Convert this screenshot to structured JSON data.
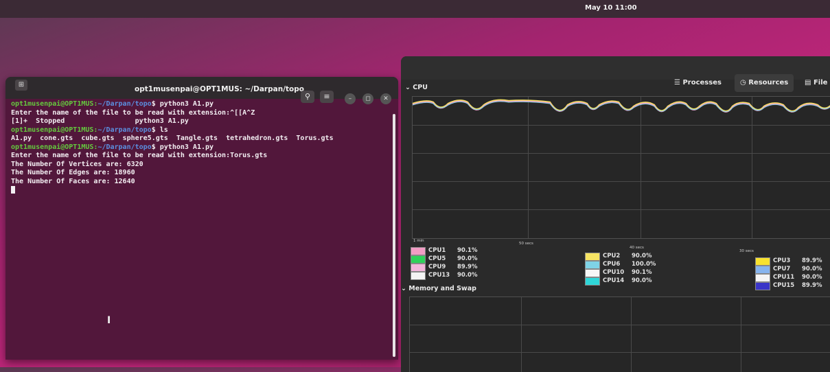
{
  "topbar": {
    "clock": "May 10  11:00"
  },
  "terminal": {
    "title": "opt1musenpai@OPT1MUS: ~/Darpan/topo",
    "new_tab_icon": "new-tab-icon",
    "buttons": {
      "search": "⚲",
      "menu": "≡",
      "minimize": "–",
      "maximize": "◻",
      "close": "✕"
    },
    "lines": [
      {
        "prompt": "opt1musenpai@OPT1MUS:",
        "path": "~/Darpan/topo",
        "text": "$ python3 A1.py"
      },
      {
        "text": "Enter the name of the file to be read with extension:^[[A^Z"
      },
      {
        "text": "[1]+  Stopped                 python3 A1.py"
      },
      {
        "prompt": "opt1musenpai@OPT1MUS:",
        "path": "~/Darpan/topo",
        "text": "$ ls"
      },
      {
        "text": "A1.py  cone.gts  cube.gts  sphere5.gts  Tangle.gts  tetrahedron.gts  Torus.gts"
      },
      {
        "prompt": "opt1musenpai@OPT1MUS:",
        "path": "~/Darpan/topo",
        "text": "$ python3 A1.py"
      },
      {
        "text": "Enter the name of the file to be read with extension:Torus.gts"
      },
      {
        "text": "The Number Of Vertices are: 6320"
      },
      {
        "text": "The Number Of Edges are: 18960"
      },
      {
        "text": "The Number Of Faces are: 12640"
      }
    ]
  },
  "monitor": {
    "tabs": {
      "processes": "Processes",
      "resources": "Resources",
      "files": "File"
    },
    "cpu_section": "CPU",
    "memory_section": "Memory and Swap",
    "time_ticks": [
      "1 min",
      "50 secs",
      "40 secs",
      "30 secs"
    ],
    "cpu_legend": [
      {
        "name": "CPU1",
        "value": "90.1%",
        "color": "#f29cc4"
      },
      {
        "name": "CPU5",
        "value": "90.0%",
        "color": "#2fd15a"
      },
      {
        "name": "CPU9",
        "value": "89.9%",
        "color": "#f3b6dc"
      },
      {
        "name": "CPU13",
        "value": "90.0%",
        "color": "#f4f4f4"
      },
      {
        "name": "CPU2",
        "value": "90.0%",
        "color": "#f6e463"
      },
      {
        "name": "CPU6",
        "value": "100.0%",
        "color": "#7fd3e6"
      },
      {
        "name": "CPU10",
        "value": "90.1%",
        "color": "#f7f7f7"
      },
      {
        "name": "CPU14",
        "value": "90.0%",
        "color": "#2fd6d8"
      },
      {
        "name": "CPU3",
        "value": "89.9%",
        "color": "#f8e22e"
      },
      {
        "name": "CPU7",
        "value": "90.0%",
        "color": "#86b4ee"
      },
      {
        "name": "CPU11",
        "value": "90.0%",
        "color": "#f5f5f5"
      },
      {
        "name": "CPU15",
        "value": "89.9%",
        "color": "#3a35c8"
      }
    ]
  }
}
